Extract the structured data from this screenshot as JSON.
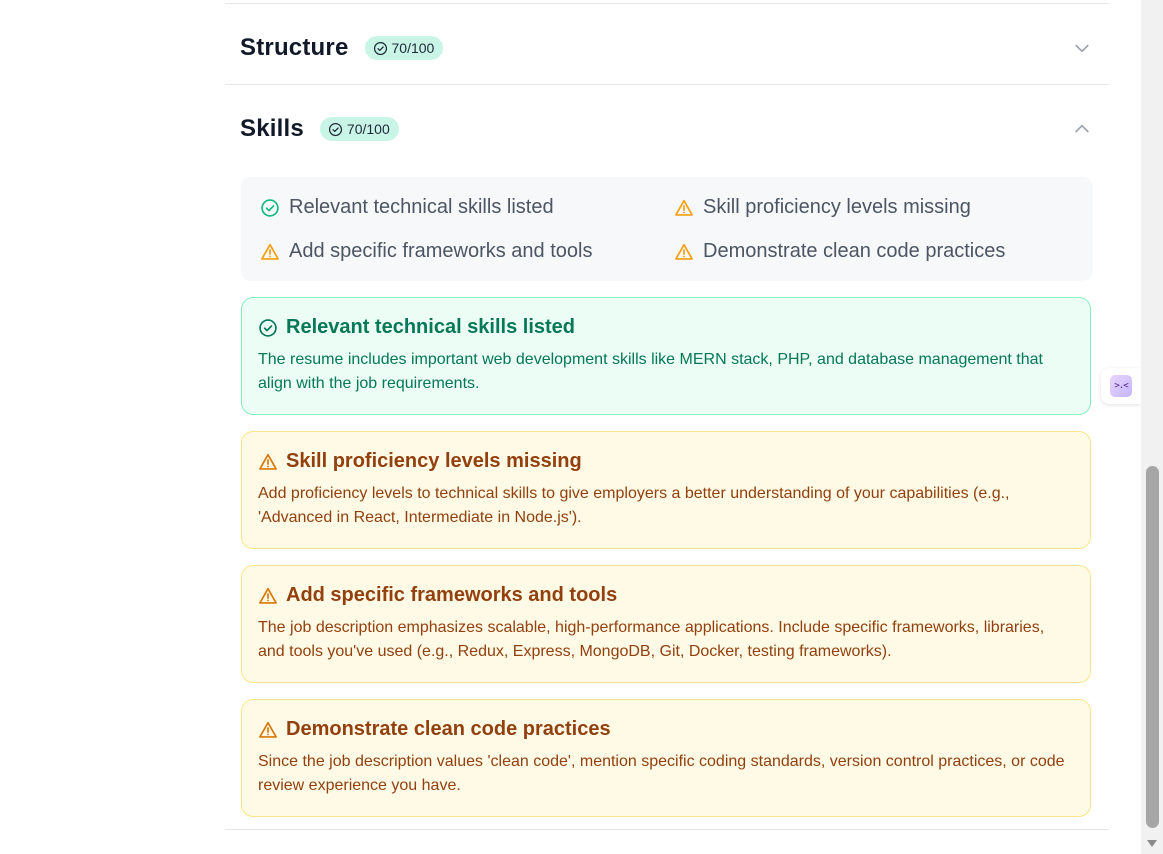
{
  "sections": {
    "structure": {
      "title": "Structure",
      "score": "70/100"
    },
    "skills": {
      "title": "Skills",
      "score": "70/100"
    }
  },
  "summary": [
    {
      "status": "good",
      "icon": "check-circle-icon",
      "label": "Relevant technical skills listed"
    },
    {
      "status": "warning",
      "icon": "warning-icon",
      "label": "Skill proficiency levels missing"
    },
    {
      "status": "warning",
      "icon": "warning-icon",
      "label": "Add specific frameworks and tools"
    },
    {
      "status": "warning",
      "icon": "warning-icon",
      "label": "Demonstrate clean code practices"
    }
  ],
  "cards": [
    {
      "status": "good",
      "title": "Relevant technical skills listed",
      "body": "The resume includes important web development skills like MERN stack, PHP, and database management that align with the job requirements."
    },
    {
      "status": "warning",
      "title": "Skill proficiency levels missing",
      "body": "Add proficiency levels to technical skills to give employers a better understanding of your capabilities (e.g., 'Advanced in React, Intermediate in Node.js')."
    },
    {
      "status": "warning",
      "title": "Add specific frameworks and tools",
      "body": "The job description emphasizes scalable, high-performance applications. Include specific frameworks, libraries, and tools you've used (e.g., Redux, Express, MongoDB, Git, Docker, testing frameworks)."
    },
    {
      "status": "warning",
      "title": "Demonstrate clean code practices",
      "body": "Since the job description values 'clean code', mention specific coding standards, version control practices, or code review experience you have."
    }
  ],
  "side_widget": {
    "icon": "assistant-icon",
    "glyph": ">.<"
  },
  "colors": {
    "good": "#10b981",
    "good_text": "#047857",
    "warning": "#f59e0b",
    "warning_text": "#92400e",
    "badge_bg": "#c9f5e6"
  }
}
